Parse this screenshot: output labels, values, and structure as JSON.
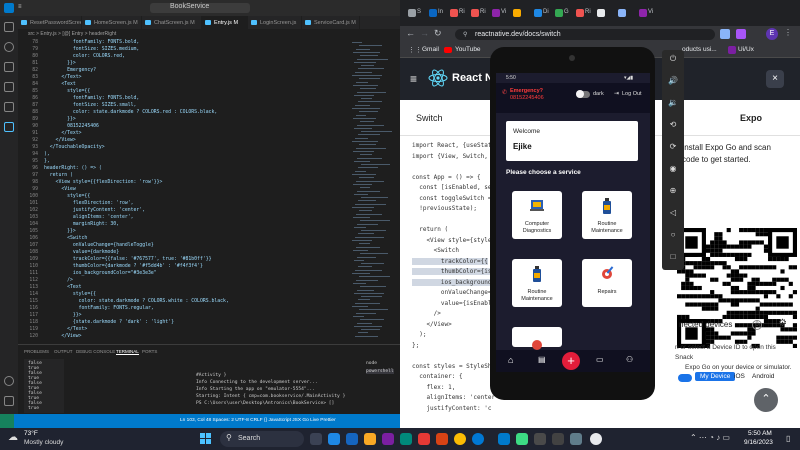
{
  "vscode": {
    "title": "BookService",
    "tabs": [
      "ResetPasswordScreen.js M",
      "HomeScreen.js M",
      "ChatScreen.js M",
      "Entry.js M",
      "LoginScreen.js",
      "ServiceCard.js M"
    ],
    "breadcrumb": "src > Entry.js > [@] Entry > headerRight",
    "code_lines": [
      {
        "n": "78",
        "t": "          fontFamily: FONTS.bold,"
      },
      {
        "n": "79",
        "t": "          fontSize: SIZES.medium,"
      },
      {
        "n": "80",
        "t": "          color: COLORS.red,"
      },
      {
        "n": "81",
        "t": "        }}>"
      },
      {
        "n": "82",
        "t": "        Emergency?"
      },
      {
        "n": "83",
        "t": "      </Text>"
      },
      {
        "n": "84",
        "t": "      <Text"
      },
      {
        "n": "85",
        "t": "        style={{"
      },
      {
        "n": "86",
        "t": "          fontFamily: FONTS.bold,"
      },
      {
        "n": "87",
        "t": "          fontSize: SIZES.small,"
      },
      {
        "n": "88",
        "t": "          color: state.darkmode ? COLORS.red : COLORS.black,"
      },
      {
        "n": "89",
        "t": "        }}>"
      },
      {
        "n": "90",
        "t": "        08152245406"
      },
      {
        "n": "91",
        "t": "      </Text>"
      },
      {
        "n": "92",
        "t": "    </View>"
      },
      {
        "n": "93",
        "t": "  </TouchableOpacity>"
      },
      {
        "n": "94",
        "t": "),"
      },
      {
        "n": "95",
        "t": "},"
      },
      {
        "n": "96",
        "t": "headerRight: () => ("
      },
      {
        "n": "97",
        "t": "  return ("
      },
      {
        "n": "98",
        "t": "    <View style={{flexDirection: 'row'}}>"
      },
      {
        "n": "99",
        "t": "      <View"
      },
      {
        "n": "100",
        "t": "        style={{"
      },
      {
        "n": "101",
        "t": "          flexDirection: 'row',"
      },
      {
        "n": "102",
        "t": "          justifyContent: 'center',"
      },
      {
        "n": "103",
        "t": "          alignItems: 'center',"
      },
      {
        "n": "104",
        "t": "          marginRight: 30,"
      },
      {
        "n": "105",
        "t": "        }}>"
      },
      {
        "n": "106",
        "t": "        <Switch"
      },
      {
        "n": "107",
        "t": "          onValueChange={handleToggle}"
      },
      {
        "n": "108",
        "t": "          value={darkmode}"
      },
      {
        "n": "109",
        "t": "          trackColor={{false: '#767577', true: '#81b0ff'}}"
      },
      {
        "n": "110",
        "t": "          thumbColor={darkmode ? '#f5dd4b' : '#f4f3f4'}"
      },
      {
        "n": "111",
        "t": "          ios_backgroundColor=\"#3e3e3e\""
      },
      {
        "n": "112",
        "t": "        />"
      },
      {
        "n": "113",
        "t": "        <Text"
      },
      {
        "n": "114",
        "t": "          style={{"
      },
      {
        "n": "115",
        "t": "            color: state.darkmode ? COLORS.white : COLORS.black,"
      },
      {
        "n": "116",
        "t": "            fontFamily: FONTS.regular,"
      },
      {
        "n": "117",
        "t": "          }}>"
      },
      {
        "n": "118",
        "t": "          {state.darkmode ? 'dark' : 'light'}"
      },
      {
        "n": "119",
        "t": "        </Text>"
      },
      {
        "n": "120",
        "t": "      </View>"
      }
    ],
    "panel_tabs": [
      "PROBLEMS",
      "OUTPUT",
      "DEBUG CONSOLE",
      "TERMINAL",
      "PORTS"
    ],
    "terminal_left": [
      "false",
      "true",
      "false",
      "true",
      "false",
      "true",
      "false",
      "true",
      "false",
      "true"
    ],
    "terminal_right": [
      "#Activity }",
      "Info Connecting to the development server...",
      "Info Starting the app on \"emulator-5554\"...",
      "Starting: Intent { cmp=com.bookservice/.MainActivity }",
      "PS C:\\Users\\user\\Desktop\\Antronics\\BookService> []"
    ],
    "terminal_list": [
      "node",
      "powershell"
    ],
    "status": "Ln 103, Col 48   Spaces: 2   UTF-8   CRLF   {} JavaScript JSX   Go Live   Prettier"
  },
  "chrome": {
    "tabs": [
      "S",
      "In",
      "Ri",
      "Ri",
      "Vi",
      "",
      "Di",
      "G",
      "Ri",
      "",
      "",
      "Vi"
    ],
    "url": "reactnative.dev/docs/switch",
    "bookmarks": [
      "Gmail",
      "YouTube",
      "oducts usi...",
      "Ui/Ux"
    ],
    "rn_brand": "React N",
    "switch_label": "Switch",
    "expo_label": "Expo",
    "expo_text_1": "Install Expo Go and scan",
    "expo_text_2": "code to get started.",
    "code_lines": [
      "import React, {useState",
      "import {View, Switch, S",
      "",
      "const App = () => {",
      "  const [isEnabled, set",
      "  const toggleSwitch =",
      "  !previousState);",
      "",
      "  return (",
      "    <View style={style",
      "      <Switch",
      "        trackColor={{",
      "        thumbColor={is",
      "        ios_background",
      "        onValueChange=",
      "        value={isEnabl",
      "      />",
      "    </View>",
      "  );",
      "};",
      "",
      "const styles = StyleSh",
      "  container: {",
      "    flex: 1,",
      "    alignItems: 'center",
      "    justifyContent: 'c"
    ],
    "devices_label": "nected devices",
    "devices_text_1": "n or select a Device ID to open this Snack",
    "devices_text_2": "Expo Go on your device or simulator.",
    "device_tabs": [
      "My Device",
      "iOS",
      "Android"
    ]
  },
  "emulator": {
    "time": "5:50",
    "emergency_label": "Emergency?",
    "phone_number": "08152245406",
    "dark_label": "dark",
    "logout_label": "Log Out",
    "welcome_label": "Welcome",
    "user_name": "Ejike",
    "prompt": "Please choose a service",
    "services": [
      {
        "label": "Computer Diagnostics"
      },
      {
        "label": "Routine Maintenance"
      },
      {
        "label": "Routine Maintenance"
      },
      {
        "label": "Repairs"
      }
    ]
  },
  "taskbar": {
    "weather_temp": "73°F",
    "weather_text": "Mostly cloudy",
    "search_label": "Search",
    "time": "5:50 AM",
    "date": "9/16/2023"
  }
}
